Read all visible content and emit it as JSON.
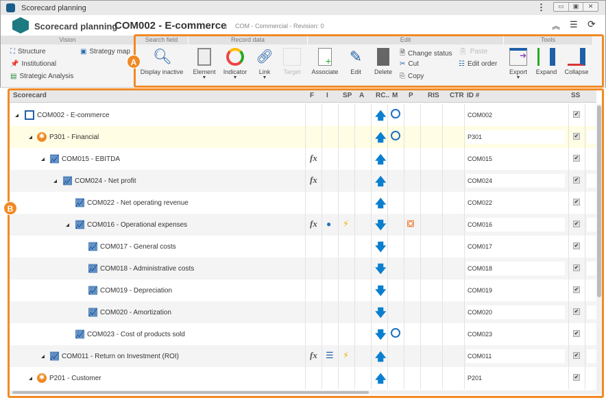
{
  "window": {
    "title": "Scorecard planning"
  },
  "header": {
    "breadcrumb_root": "Scorecard planning",
    "title": "COM002 - E-commerce",
    "subtitle": "COM - Commercial - Revision: 0"
  },
  "ribbon": {
    "vision": {
      "title": "Vision",
      "items": [
        "Structure",
        "Strategy map",
        "Institutional",
        "Strategic Analysis"
      ]
    },
    "search": {
      "title": "Search field",
      "display_inactive": "Display inactive"
    },
    "record": {
      "title": "Record data",
      "element": "Element",
      "indicator": "Indicator",
      "link": "Link",
      "target": "Target"
    },
    "edit": {
      "title": "Edit",
      "associate": "Associate",
      "edit": "Edit",
      "delete": "Delete",
      "change_status": "Change status",
      "cut": "Cut",
      "copy": "Copy",
      "paste": "Paste",
      "edit_order": "Edit order"
    },
    "tools": {
      "title": "Tools",
      "export": "Export",
      "expand": "Expand",
      "collapse": "Collapse"
    }
  },
  "callouts": {
    "a": "A",
    "b": "B"
  },
  "accent": "#f08a24",
  "grid": {
    "columns": [
      "Scorecard",
      "F",
      "I",
      "SP",
      "A",
      "RC..",
      "M",
      "P",
      "RIS",
      "CTR",
      "ID #",
      "SS"
    ],
    "rows": [
      {
        "name": "COM002 - E-commerce",
        "level": 0,
        "type": "scorecard",
        "id": "COM002",
        "f": "",
        "i": "",
        "sp": "",
        "rc": "up",
        "m": "compass",
        "p": "",
        "ss": true
      },
      {
        "name": "P301 - Financial",
        "level": 1,
        "type": "perspective",
        "id": "P301",
        "f": "",
        "i": "",
        "sp": "",
        "rc": "up",
        "m": "compass",
        "p": "",
        "ss": true
      },
      {
        "name": "COM015 - EBITDA",
        "level": 2,
        "type": "indicator",
        "id": "COM015",
        "f": "fx",
        "i": "",
        "sp": "",
        "rc": "up",
        "m": "",
        "p": "",
        "ss": true
      },
      {
        "name": "COM024 - Net profit",
        "level": 3,
        "type": "indicator",
        "id": "COM024",
        "f": "fx",
        "i": "",
        "sp": "",
        "rc": "up",
        "m": "",
        "p": "",
        "ss": true
      },
      {
        "name": "COM022 - Net operating revenue",
        "level": 4,
        "type": "indicator",
        "id": "COM022",
        "f": "",
        "i": "",
        "sp": "",
        "rc": "up",
        "m": "",
        "p": "",
        "ss": true
      },
      {
        "name": "COM016 - Operational expenses",
        "level": 4,
        "type": "indicator",
        "expandable": true,
        "id": "COM016",
        "f": "fx",
        "i": "bulb",
        "sp": "bolt",
        "rc": "down",
        "m": "",
        "p": "plan",
        "ss": true
      },
      {
        "name": "COM017 - General costs",
        "level": 5,
        "type": "indicator",
        "id": "COM017",
        "f": "",
        "i": "",
        "sp": "",
        "rc": "down",
        "m": "",
        "p": "",
        "ss": true
      },
      {
        "name": "COM018 - Administrative costs",
        "level": 5,
        "type": "indicator",
        "id": "COM018",
        "f": "",
        "i": "",
        "sp": "",
        "rc": "down",
        "m": "",
        "p": "",
        "ss": true
      },
      {
        "name": "COM019 - Depreciation",
        "level": 5,
        "type": "indicator",
        "id": "COM019",
        "f": "",
        "i": "",
        "sp": "",
        "rc": "down",
        "m": "",
        "p": "",
        "ss": true
      },
      {
        "name": "COM020 - Amortization",
        "level": 5,
        "type": "indicator",
        "id": "COM020",
        "f": "",
        "i": "",
        "sp": "",
        "rc": "down",
        "m": "",
        "p": "",
        "ss": true
      },
      {
        "name": "COM023 - Cost of products sold",
        "level": 4,
        "type": "indicator",
        "id": "COM023",
        "f": "",
        "i": "",
        "sp": "",
        "rc": "down",
        "m": "compass",
        "p": "",
        "ss": true
      },
      {
        "name": "COM011 - Return on Investment (ROI)",
        "level": 2,
        "type": "indicator",
        "id": "COM011",
        "f": "fx",
        "i": "list",
        "sp": "bolt",
        "rc": "up",
        "m": "",
        "p": "",
        "ss": true
      },
      {
        "name": "P201 - Customer",
        "level": 1,
        "type": "perspective",
        "id": "P201",
        "f": "",
        "i": "",
        "sp": "",
        "rc": "up",
        "m": "",
        "p": "",
        "ss": true
      }
    ]
  }
}
